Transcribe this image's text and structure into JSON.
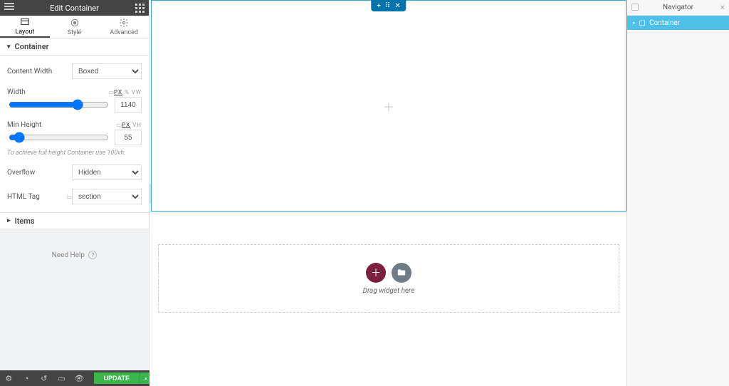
{
  "header": {
    "title": "Edit Container"
  },
  "tabs": {
    "layout": "Layout",
    "style": "Style",
    "advanced": "Advanced"
  },
  "container": {
    "section_label": "Container",
    "content_width_label": "Content Width",
    "content_width_value": "Boxed",
    "width_label": "Width",
    "width_value": "1140",
    "width_units": {
      "px": "PX",
      "pct": "%",
      "vw": "VW"
    },
    "minh_label": "Min Height",
    "minh_value": "55",
    "minh_units": {
      "px": "PX",
      "vh": "VH"
    },
    "hint": "To achieve full height Container use 100vh.",
    "overflow_label": "Overflow",
    "overflow_value": "Hidden",
    "htmltag_label": "HTML Tag",
    "htmltag_value": "section"
  },
  "items": {
    "section_label": "Items"
  },
  "help": {
    "text": "Need Help"
  },
  "footer": {
    "update": "UPDATE"
  },
  "canvas": {
    "handle": {
      "plus": "+",
      "dots": "⠿",
      "close": "✕"
    },
    "drag_text": "Drag widget here"
  },
  "navigator": {
    "title": "Navigator",
    "item": "Container"
  }
}
